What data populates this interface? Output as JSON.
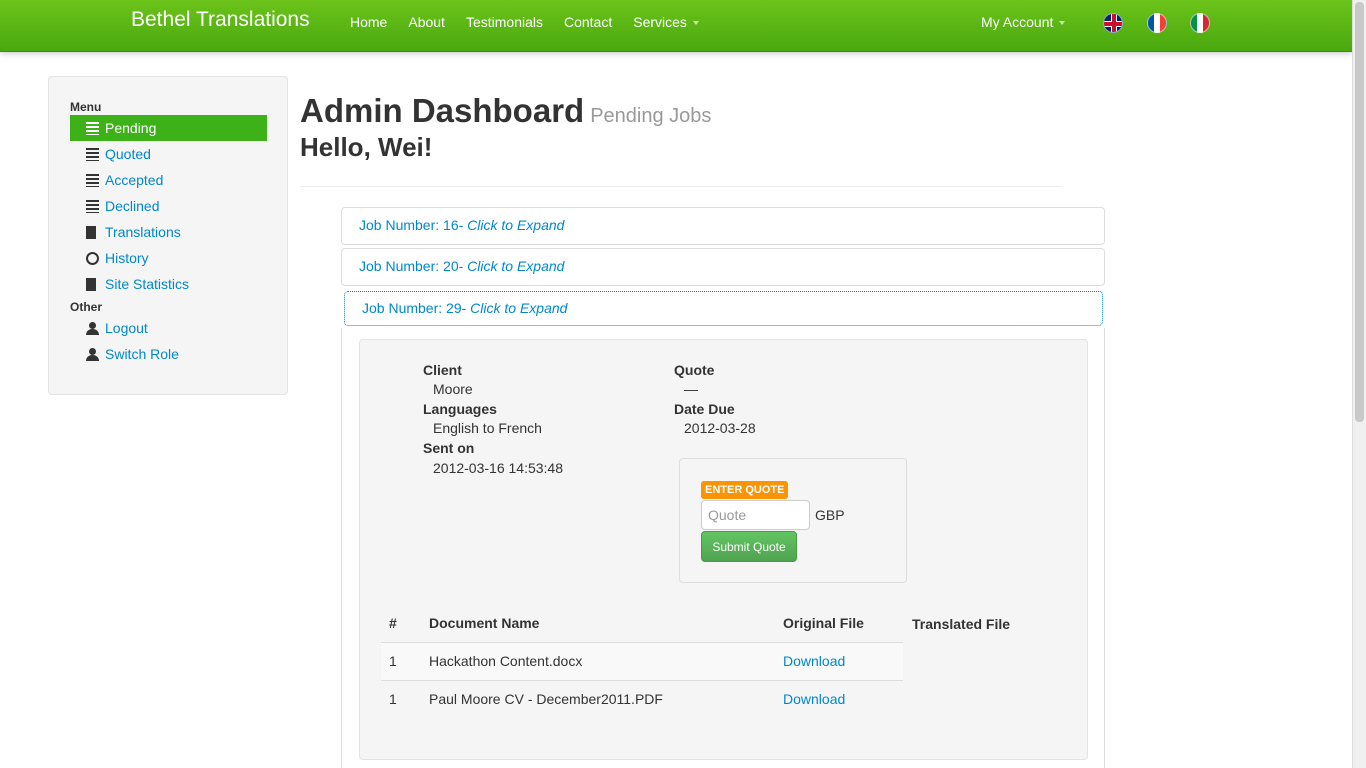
{
  "navbar": {
    "brand": "Bethel Translations",
    "links": [
      "Home",
      "About",
      "Testimonials",
      "Contact"
    ],
    "services": "Services",
    "account": "My Account",
    "flags": [
      "uk-flag-icon",
      "france-flag-icon",
      "italy-flag-icon"
    ],
    "color": "#4aa80f"
  },
  "sidebar": {
    "menu_header": "Menu",
    "items": [
      {
        "label": "Pending",
        "icon": "list-icon",
        "active": true
      },
      {
        "label": "Quoted",
        "icon": "list-icon"
      },
      {
        "label": "Accepted",
        "icon": "list-icon"
      },
      {
        "label": "Declined",
        "icon": "list-icon"
      },
      {
        "label": "Translations",
        "icon": "file-icon"
      },
      {
        "label": "History",
        "icon": "clock-icon"
      },
      {
        "label": "Site Statistics",
        "icon": "book-icon"
      }
    ],
    "other_header": "Other",
    "other_items": [
      {
        "label": "Logout",
        "icon": "user-icon"
      },
      {
        "label": "Switch Role",
        "icon": "user-icon"
      }
    ]
  },
  "page": {
    "title": "Admin Dashboard",
    "subtitle": "Pending Jobs",
    "greeting": "Hello, Wei!"
  },
  "jobs": [
    {
      "prefix": "Job Number: 16- ",
      "action": "Click to Expand"
    },
    {
      "prefix": "Job Number: 20- ",
      "action": "Click to Expand"
    },
    {
      "prefix": "Job Number: 29- ",
      "action": "Click to Expand"
    }
  ],
  "job_detail": {
    "client_label": "Client",
    "client": "Moore",
    "languages_label": "Languages",
    "languages": "English to French",
    "sent_label": "Sent on",
    "sent": "2012-03-16 14:53:48",
    "quote_label": "Quote",
    "quote": "—",
    "due_label": "Date Due",
    "due": "2012-03-28",
    "enter_quote_badge": "ENTER QUOTE",
    "quote_placeholder": "Quote",
    "currency": "GBP",
    "submit": "Submit Quote"
  },
  "documents": {
    "headers": [
      "#",
      "Document Name",
      "Original File",
      "Translated File"
    ],
    "rows": [
      {
        "num": "1",
        "name": "Hackathon Content.docx",
        "original": "Download"
      },
      {
        "num": "1",
        "name": "Paul Moore CV - December2011.PDF",
        "original": "Download"
      }
    ]
  }
}
